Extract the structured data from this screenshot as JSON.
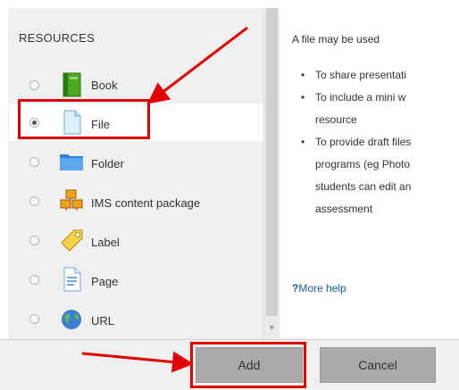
{
  "left": {
    "section_title": "RESOURCES",
    "items": [
      {
        "label": "Book",
        "icon": "book-icon",
        "selected": false
      },
      {
        "label": "File",
        "icon": "file-icon",
        "selected": true
      },
      {
        "label": "Folder",
        "icon": "folder-icon",
        "selected": false
      },
      {
        "label": "IMS content package",
        "icon": "ims-package-icon",
        "selected": false
      },
      {
        "label": "Label",
        "icon": "label-tag-icon",
        "selected": false
      },
      {
        "label": "Page",
        "icon": "page-icon",
        "selected": false
      },
      {
        "label": "URL",
        "icon": "url-globe-icon",
        "selected": false
      }
    ]
  },
  "right": {
    "intro": "A file may be used",
    "bullets": [
      [
        "To share presentati"
      ],
      [
        "To include a mini w",
        "resource"
      ],
      [
        "To provide draft files",
        "programs (eg Photo",
        "students can edit an",
        "assessment"
      ]
    ],
    "help_link": "More help",
    "help_prefix": "?"
  },
  "buttons": {
    "add": "Add",
    "cancel": "Cancel"
  },
  "colors": {
    "annotation": "#e00000",
    "link": "#1e5aa0"
  }
}
